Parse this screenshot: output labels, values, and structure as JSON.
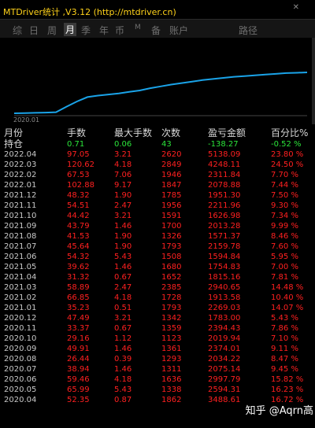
{
  "window": {
    "title": "MTDriver统计 ,V3.12 (http://mtdriver.cn)",
    "close_glyph": "✕"
  },
  "tabs": [
    "综",
    "日",
    "周",
    "月",
    "季",
    "年",
    "币",
    "M",
    "备",
    "账户",
    "路径"
  ],
  "active_tab": "月",
  "chart": {
    "start_label": "2020.01",
    "line_color": "#1aa3e8"
  },
  "chart_data": {
    "type": "line",
    "x_start": "2020.01",
    "series": [
      {
        "values": [
          0.0,
          0.3,
          0.6,
          1.0,
          1.5,
          9.0,
          16.0,
          22.0,
          24.0,
          25.5,
          27.0,
          29.0,
          31.0,
          34.0,
          36.5,
          39.0,
          41.0,
          43.0,
          45.0,
          46.5,
          48.0,
          49.5,
          50.5,
          51.5,
          52.5,
          53.5,
          54.5,
          55.0,
          55.5
        ]
      }
    ]
  },
  "table": {
    "headers": [
      "月份",
      "手数",
      "最大手数",
      "次数",
      "盈亏金额",
      "百分比%"
    ],
    "holding": [
      "持仓",
      "0.71",
      "0.06",
      "43",
      "-138.27",
      "-0.52 %"
    ],
    "rows": [
      [
        "2022.04",
        "97.05",
        "3.21",
        "2620",
        "5138.09",
        "23.80 %"
      ],
      [
        "2022.03",
        "120.62",
        "4.18",
        "2849",
        "4248.11",
        "24.50 %"
      ],
      [
        "2022.02",
        "67.53",
        "7.06",
        "1946",
        "2311.84",
        "7.70 %"
      ],
      [
        "2022.01",
        "102.88",
        "9.17",
        "1847",
        "2078.88",
        "7.44 %"
      ],
      [
        "2021.12",
        "48.32",
        "1.90",
        "1785",
        "1951.30",
        "7.50 %"
      ],
      [
        "2021.11",
        "54.51",
        "2.47",
        "1956",
        "2211.96",
        "9.30 %"
      ],
      [
        "2021.10",
        "44.42",
        "3.21",
        "1591",
        "1626.98",
        "7.34 %"
      ],
      [
        "2021.09",
        "43.79",
        "1.46",
        "1700",
        "2013.28",
        "9.99 %"
      ],
      [
        "2021.08",
        "41.53",
        "1.90",
        "1326",
        "1571.37",
        "8.46 %"
      ],
      [
        "2021.07",
        "45.64",
        "1.90",
        "1793",
        "2159.78",
        "7.60 %"
      ],
      [
        "2021.06",
        "54.32",
        "5.43",
        "1508",
        "1594.84",
        "5.95 %"
      ],
      [
        "2021.05",
        "39.62",
        "1.46",
        "1680",
        "1754.83",
        "7.00 %"
      ],
      [
        "2021.04",
        "31.32",
        "0.67",
        "1652",
        "1815.16",
        "7.81 %"
      ],
      [
        "2021.03",
        "58.89",
        "2.47",
        "2385",
        "2940.65",
        "14.48 %"
      ],
      [
        "2021.02",
        "66.85",
        "4.18",
        "1728",
        "1913.58",
        "10.40 %"
      ],
      [
        "2021.01",
        "35.23",
        "0.51",
        "1793",
        "2269.03",
        "14.07 %"
      ],
      [
        "2020.12",
        "47.49",
        "3.21",
        "1342",
        "1783.00",
        "5.43 %"
      ],
      [
        "2020.11",
        "33.37",
        "0.67",
        "1359",
        "2394.43",
        "7.86 %"
      ],
      [
        "2020.10",
        "29.16",
        "1.12",
        "1123",
        "2019.94",
        "7.10 %"
      ],
      [
        "2020.09",
        "49.91",
        "1.46",
        "1361",
        "2374.01",
        "9.11 %"
      ],
      [
        "2020.08",
        "26.44",
        "0.39",
        "1293",
        "2034.22",
        "8.47 %"
      ],
      [
        "2020.07",
        "38.94",
        "1.46",
        "1311",
        "2075.14",
        "9.45 %"
      ],
      [
        "2020.06",
        "59.46",
        "4.18",
        "1636",
        "2997.79",
        "15.82 %"
      ],
      [
        "2020.05",
        "65.99",
        "5.43",
        "1338",
        "2594.31",
        "16.23 %"
      ],
      [
        "2020.04",
        "52.35",
        "0.87",
        "1862",
        "3488.61",
        "16.72 %"
      ]
    ]
  },
  "watermark": "知乎 @Aqrn高"
}
